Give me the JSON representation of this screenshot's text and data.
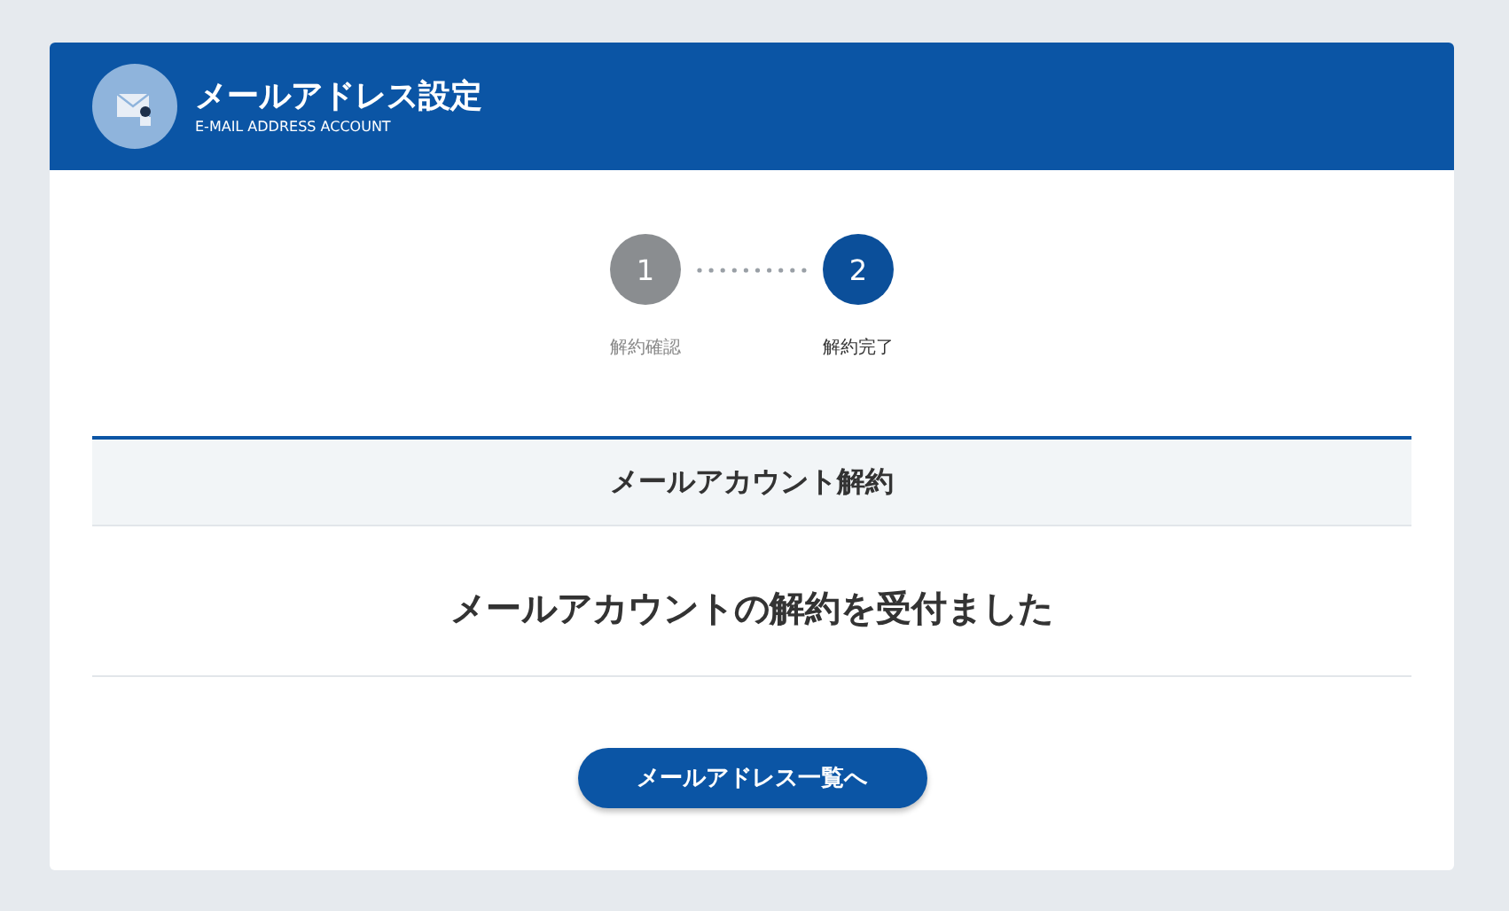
{
  "header": {
    "title": "メールアドレス設定",
    "subtitle": "E-MAIL ADDRESS ACCOUNT"
  },
  "steps": [
    {
      "number": "1",
      "label": "解約確認",
      "selected": false
    },
    {
      "number": "2",
      "label": "解約完了",
      "selected": true
    }
  ],
  "section": {
    "title": "メールアカウント解約",
    "message": "メールアカウントの解約を受付ました"
  },
  "button": {
    "label": "メールアドレス一覧へ"
  }
}
